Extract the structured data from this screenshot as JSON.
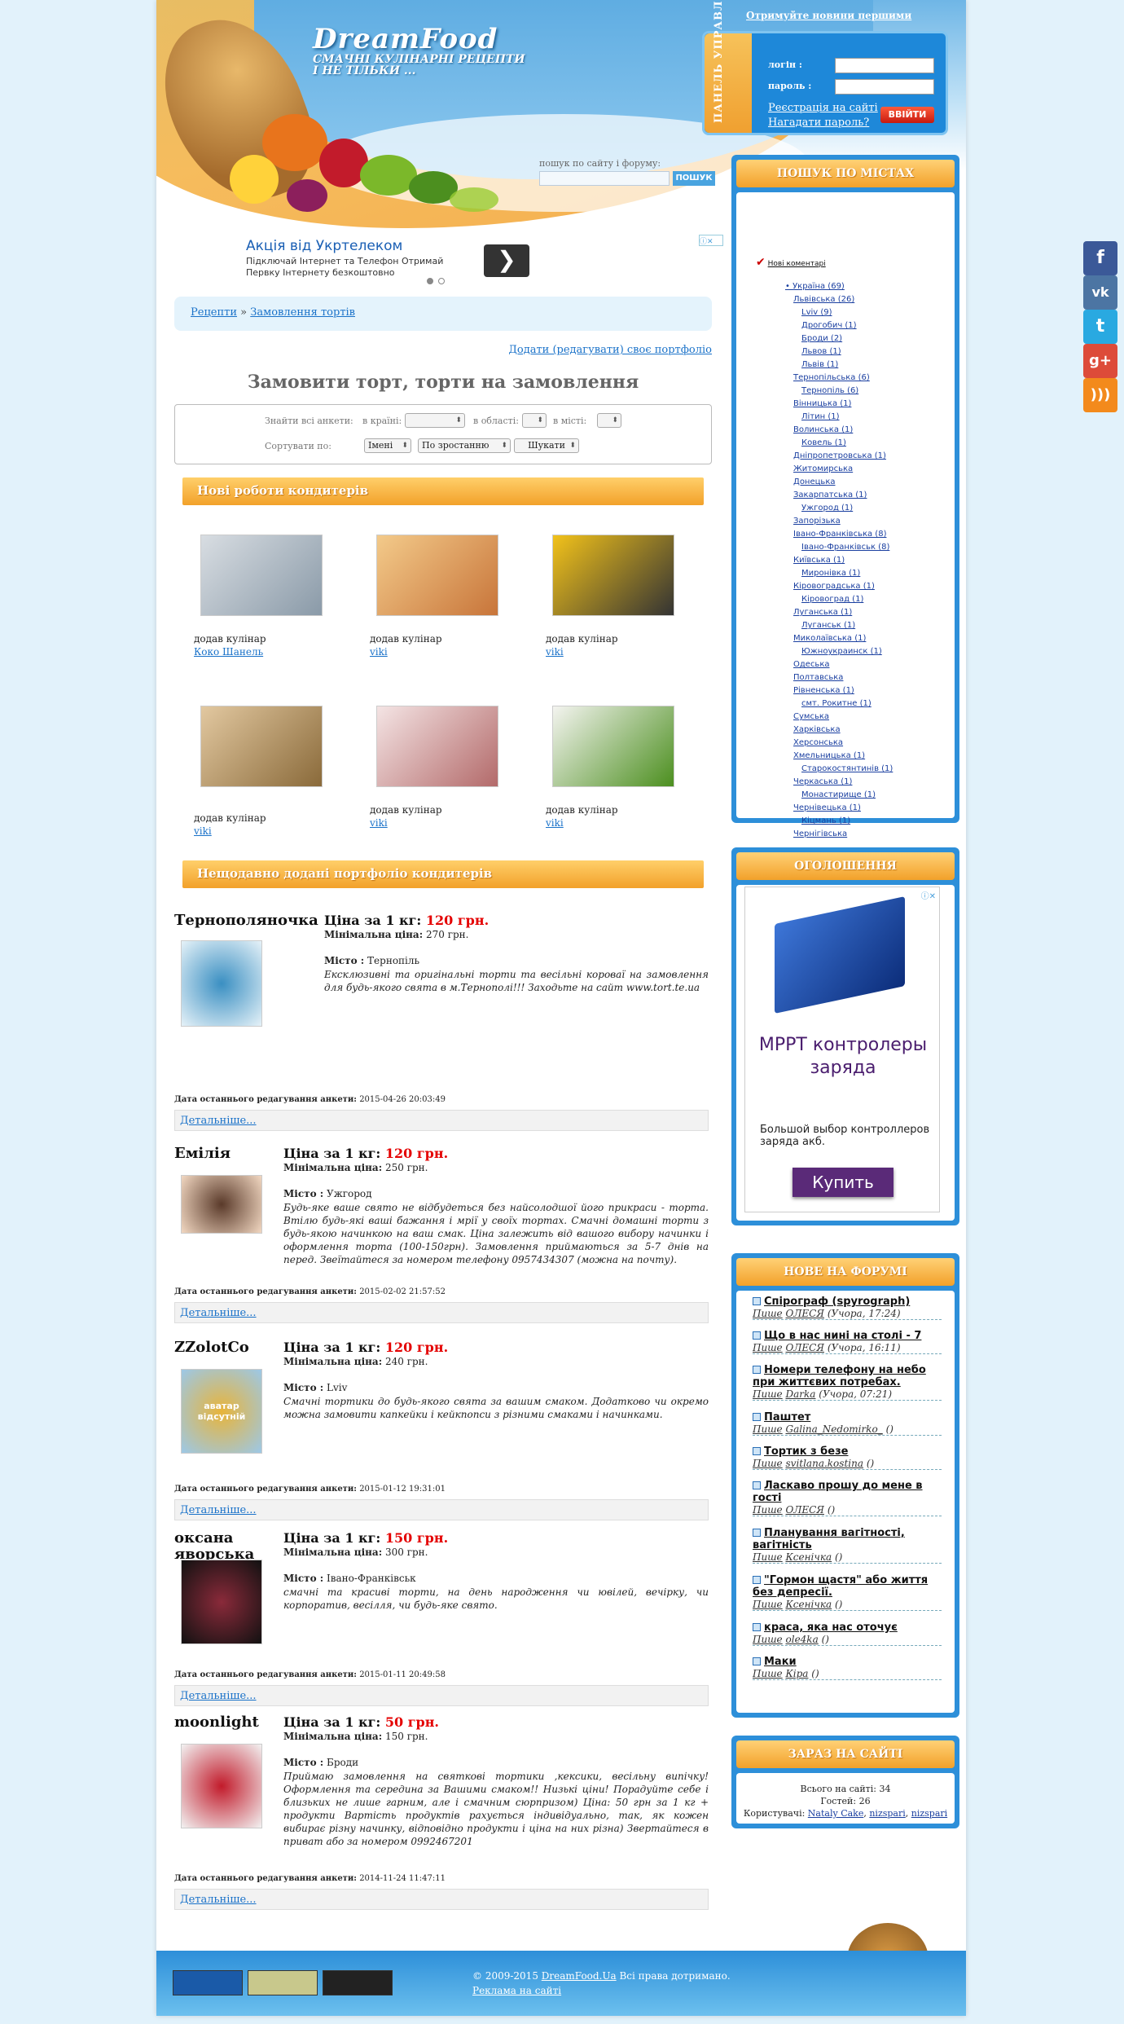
{
  "header": {
    "logo_title": "DreamFood",
    "logo_sub1": "СМАЧНІ КУЛІНАРНІ РЕЦЕПТИ",
    "logo_sub2": "І НЕ ТІЛЬКИ ...",
    "notify": "Отримуйте новини першими"
  },
  "panel": {
    "side_label": "ПАНЕЛЬ УПРАВЛЕННЯ",
    "login_label": "логін :",
    "password_label": "пароль :",
    "register_link": "Реєстрація на сайті",
    "remind_link": "Нагадати пароль?",
    "login_button": "ВВІЙТИ"
  },
  "search": {
    "label": "пошук по сайту і форуму:",
    "button": "ПОШУК"
  },
  "ad": {
    "title": "Акція від Укртелеком",
    "line1": "Підключай Інтернет та Телефон Отримай",
    "line2": "Первку Інтернету безкоштовно",
    "arrow": "❯"
  },
  "breadcrumb": {
    "item1": "Рецепти",
    "sep": "»",
    "item2": "Замовлення тортів"
  },
  "content": {
    "add_portfolio": "Додати (редагувати) своє портфоліо",
    "page_title": "Замовити торт, торти на замовлення"
  },
  "filter": {
    "search_all": "Знайти всі анкети:",
    "in_country": "в країні:",
    "in_region": "в області:",
    "in_city": "в місті:",
    "sort_by": "Сортувати по:",
    "sort_field": "Імені",
    "sort_order": "По зростанню",
    "search_button": "Шукати"
  },
  "new_works": {
    "title": "Нові роботи кондитерів",
    "added_label": "додав кулінар",
    "items": [
      {
        "author": "Коко Шанель"
      },
      {
        "author": "viki"
      },
      {
        "author": "viki"
      },
      {
        "author": "viki"
      },
      {
        "author": "viki"
      },
      {
        "author": "viki"
      }
    ]
  },
  "recent": {
    "title": "Нещодавно додані портфоліо кондитерів",
    "price_label": "Ціна за 1 кг:",
    "min_label": "Мінімальна ціна:",
    "place_label": "Місто :",
    "date_label": "Дата останнього редагування анкети:",
    "more_label": "Детальніше...",
    "items": [
      {
        "name": "Тернополяночка",
        "price": "120 грн.",
        "min": "270 грн.",
        "city": "Тернопіль",
        "desc": "Ексклюзивні та оригінальні торти та весільні короваї на замовлення для будь-якого свята в м.Тернополі!!! Заходьте на сайт www.tort.te.ua",
        "date": "2015-04-26 20:03:49"
      },
      {
        "name": "Емілія",
        "price": "120 грн.",
        "min": "250 грн.",
        "city": "Ужгород",
        "desc": "Будь-яке ваше свято не відбудеться без найсолодшої його прикраси - торта. Втілю будь-які ваші бажання і мрії у своїх тортах. Смачні домашні торти з будь-якою начинкою на ваш смак. Ціна залежить від вашого вибору начинки і оформлення торта (100-150грн). Замовлення приймаються за 5-7 днів на перед. Звеїтайтеся за номером телефону 0957434307 (можна на почту).",
        "date": "2015-02-02 21:57:52"
      },
      {
        "name": "ZZolotCo",
        "price": "120 грн.",
        "min": "240 грн.",
        "city": "Lviv",
        "desc": "Смачні тортики до будь-якого свята за вашим смаком. Додатково чи окремо можна замовити капкейки і кейкпопси з різними смаками і начинками.",
        "date": "2015-01-12 19:31:01",
        "avatar_text": "аватар відсутній"
      },
      {
        "name": "оксана яворська",
        "price": "150 грн.",
        "min": "300 грн.",
        "city": "Івано-Франківськ",
        "desc": "смачні та красиві торти, на день народження чи ювілей, вечірку, чи корпоратив, весілля, чи будь-яке свято.",
        "date": "2015-01-11 20:49:58"
      },
      {
        "name": "moonlight",
        "price": "50 грн.",
        "min": "150 грн.",
        "city": "Броди",
        "desc": "Приймаю замовлення на святкові тортики ,кексики, весільну випічку! Оформлення та середина за Вашими смаком!! Низькі ціни! Порадуйте себе і близьких не лише гарним, але і смачним сюрпризом) Ціна: 50 грн за 1 кг + продукти Вартість продуктів рахується індивідуально, так, як кожен вибирає різну начинку, відповідно продукти і ціна на них різна) Звертайтеся в приват або за номером 0992467201",
        "date": "2014-11-24 11:47:11"
      }
    ]
  },
  "cities": {
    "title": "ПОШУК ПО МІСТАХ",
    "new_comments": "Нові коментарі",
    "list": [
      "Україна (69)",
      "Львівська (26)",
      "Lviv (9)",
      "Дрогобич (1)",
      "Броди (2)",
      "Львов (1)",
      "Львів (1)",
      "Тернопільська (6)",
      "Тернопіль (6)",
      "Вінницька (1)",
      "Літин (1)",
      "Волинська (1)",
      "Ковель (1)",
      "Дніпропетровська (1)",
      "Житомирська",
      "Донецька",
      "Закарпатська (1)",
      "Ужгород (1)",
      "Запорізька",
      "Івано-Франківська (8)",
      "Івано-Франківськ (8)",
      "Київська (1)",
      "Миронівка (1)",
      "Кіровоградська (1)",
      "Кіровоград (1)",
      "Луганська (1)",
      "Луганськ (1)",
      "Миколаївська (1)",
      "Южноукраинск (1)",
      "Одеська",
      "Полтавська",
      "Рівненська (1)",
      "смт. Рокитне (1)",
      "Сумська",
      "Харківська",
      "Херсонська",
      "Хмельницька (1)",
      "Старокостянтинів (1)",
      "Черкаська (1)",
      "Монастирище (1)",
      "Чернівецька (1)",
      "Кіцмань (1)",
      "Чернігівська"
    ]
  },
  "ads_box": {
    "title": "ОГОЛОШЕННЯ",
    "ad_title": "МРРТ контролеры заряда",
    "ad_text": "Большой выбор контроллеров заряда акб.",
    "ad_button": "Купить"
  },
  "forum": {
    "title": "НОВЕ НА ФОРУМІ",
    "writes": "Пише",
    "items": [
      {
        "t": "Спірограф (spyrograph)",
        "u": "ОЛЕСЯ",
        "w": "(Учора, 17:24)"
      },
      {
        "t": "Що в нас нині на столі - 7",
        "u": "ОЛЕСЯ",
        "w": "(Учора, 16:11)"
      },
      {
        "t": "Номери телефону на небо при життєвих потребах.",
        "u": "Darka",
        "w": "(Учора, 07:21)"
      },
      {
        "t": "Паштет",
        "u": "Galina_Nedomirko_",
        "w": "()"
      },
      {
        "t": "Тортик з безе",
        "u": "svitlana.kostina",
        "w": "()"
      },
      {
        "t": "Ласкаво прошу до мене в гості",
        "u": "ОЛЕСЯ",
        "w": "()"
      },
      {
        "t": "Планування вагітності, вагітність",
        "u": "Ксенічка",
        "w": "()"
      },
      {
        "t": "\"Гормон щастя\" або життя без депресії.",
        "u": "Ксенічка",
        "w": "()"
      },
      {
        "t": "краса, яка нас оточує",
        "u": "ole4ka",
        "w": "()"
      },
      {
        "t": "Маки",
        "u": "Кіра",
        "w": "()"
      }
    ]
  },
  "online": {
    "title": "ЗАРАЗ НА САЙТІ",
    "total": "Всього на сайті: 34",
    "guests": "Гостей: 26",
    "users_label": "Користувачі:",
    "users": [
      "Nataly Cake",
      "nizspari",
      "nizspari"
    ]
  },
  "footer": {
    "copy": "© 2009-2015",
    "site": "DreamFood.Ua",
    "rights": "Всі права дотримано.",
    "ads_link": "Реклама на сайті"
  },
  "social": [
    "f",
    "vk",
    "t",
    "g+",
    "rss"
  ]
}
